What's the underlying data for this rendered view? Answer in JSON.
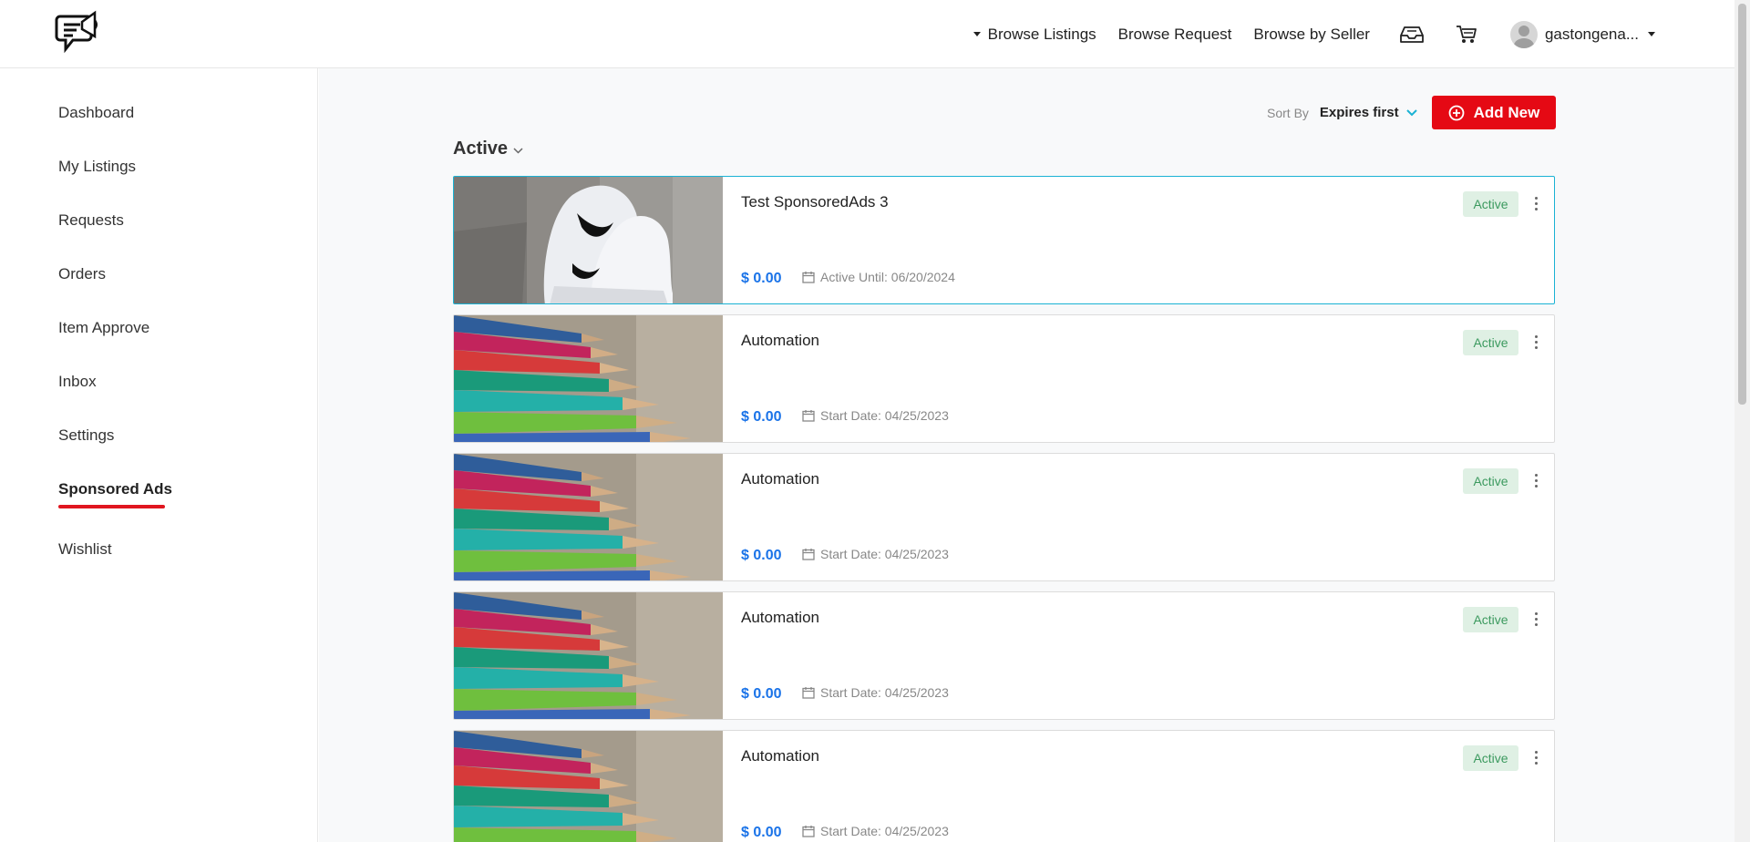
{
  "header": {
    "logo_name": "chat-megaphone-logo",
    "nav": {
      "browse_listings": "Browse Listings",
      "browse_request": "Browse Request",
      "browse_by_seller": "Browse by Seller"
    },
    "icons": [
      "inbox-icon",
      "cart-icon"
    ],
    "username": "gastongena..."
  },
  "sidebar": {
    "items": [
      {
        "label": "Dashboard"
      },
      {
        "label": "My Listings"
      },
      {
        "label": "Requests"
      },
      {
        "label": "Orders"
      },
      {
        "label": "Item Approve"
      },
      {
        "label": "Inbox"
      },
      {
        "label": "Settings"
      },
      {
        "label": "Sponsored Ads",
        "active": true
      },
      {
        "label": "Wishlist"
      }
    ],
    "accent_color": "#e0161f"
  },
  "toolbar": {
    "sort_label": "Sort By",
    "sort_value": "Expires first",
    "add_label": "Add New"
  },
  "section": {
    "title": "Active"
  },
  "ads": [
    {
      "title": "Test SponsoredAds 3",
      "price": "$ 0.00",
      "date": "Active Until: 06/20/2024",
      "status": "Active",
      "image": "sneakers-photo",
      "selected": true
    },
    {
      "title": "Automation",
      "price": "$ 0.00",
      "date": "Start Date: 04/25/2023",
      "status": "Active",
      "image": "colored-pencils-photo"
    },
    {
      "title": "Automation",
      "price": "$ 0.00",
      "date": "Start Date: 04/25/2023",
      "status": "Active",
      "image": "colored-pencils-photo"
    },
    {
      "title": "Automation",
      "price": "$ 0.00",
      "date": "Start Date: 04/25/2023",
      "status": "Active",
      "image": "colored-pencils-photo"
    },
    {
      "title": "Automation",
      "price": "$ 0.00",
      "date": "Start Date: 04/25/2023",
      "status": "Active",
      "image": "colored-pencils-photo"
    }
  ],
  "colors": {
    "primary_red": "#e50914",
    "price_blue": "#1a73e8",
    "badge_bg": "#dff0e4",
    "badge_text": "#3c9a5f",
    "selected_border": "#1ab2d4"
  }
}
